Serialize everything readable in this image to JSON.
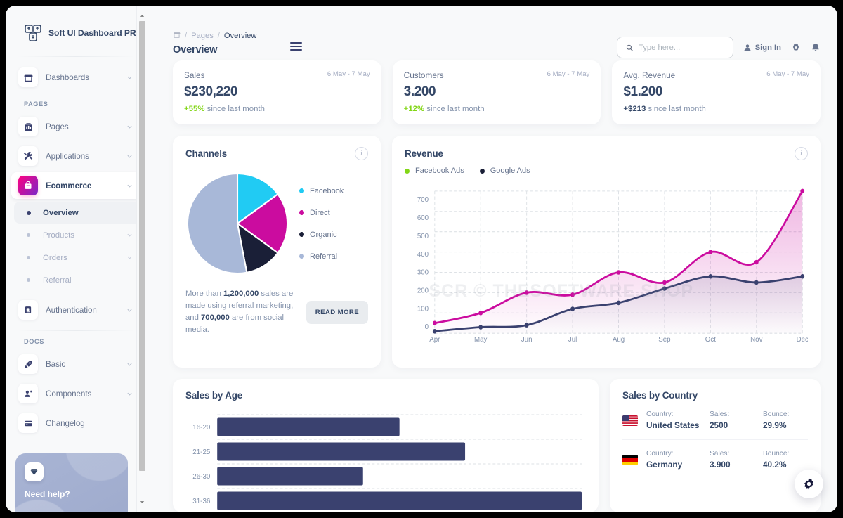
{
  "brand": {
    "name": "Soft UI Dashboard PRO",
    "logo_icon": "soft-ui-logo-icon"
  },
  "sidebar": {
    "groups": [
      {
        "label": "",
        "items": [
          {
            "label": "Dashboards",
            "icon": "shop-icon",
            "chevron": true,
            "active": false
          }
        ]
      },
      {
        "label": "PAGES",
        "items": [
          {
            "label": "Pages",
            "icon": "chart-bar-icon",
            "chevron": true,
            "active": false
          },
          {
            "label": "Applications",
            "icon": "tools-icon",
            "chevron": true,
            "active": false
          },
          {
            "label": "Ecommerce",
            "icon": "basket-icon",
            "chevron": true,
            "active": true
          },
          {
            "label": "Authentication",
            "icon": "document-icon",
            "chevron": true,
            "active": false
          }
        ]
      },
      {
        "label": "DOCS",
        "items": [
          {
            "label": "Basic",
            "icon": "rocket-icon",
            "chevron": true,
            "active": false
          },
          {
            "label": "Components",
            "icon": "badge-icon",
            "chevron": true,
            "active": false
          },
          {
            "label": "Changelog",
            "icon": "credit-card-icon",
            "chevron": false,
            "active": false
          }
        ]
      }
    ],
    "subitems": [
      {
        "label": "Overview",
        "chevron": false,
        "active": true
      },
      {
        "label": "Products",
        "chevron": true,
        "active": false
      },
      {
        "label": "Orders",
        "chevron": true,
        "active": false
      },
      {
        "label": "Referral",
        "chevron": false,
        "active": false
      }
    ],
    "help_card": {
      "title": "Need help?",
      "icon": "diamond-icon"
    }
  },
  "topbar": {
    "breadcrumb_home_icon": "shop-icon",
    "breadcrumb_parent": "Pages",
    "breadcrumb_current": "Overview",
    "separator": "/",
    "page_title": "Overview",
    "menu_icon": "hamburger-icon",
    "search": {
      "placeholder": "Type here...",
      "value": "",
      "icon": "search-icon"
    },
    "sign_in": {
      "label": "Sign In",
      "icon": "user-icon"
    },
    "settings_icon": "gear-icon",
    "bell_icon": "bell-icon"
  },
  "stats": [
    {
      "title": "Sales",
      "date": "6 May - 7 May",
      "value": "$230,220",
      "delta": "+55%",
      "delta_positive": true,
      "note": "since last month"
    },
    {
      "title": "Customers",
      "date": "6 May - 7 May",
      "value": "3.200",
      "delta": "+12%",
      "delta_positive": true,
      "note": "since last month"
    },
    {
      "title": "Avg. Revenue",
      "date": "6 May - 7 May",
      "value": "$1.200",
      "delta": "+$213",
      "delta_positive": false,
      "note": "since last month"
    }
  ],
  "channels": {
    "title": "Channels",
    "info_icon": "info-icon",
    "text_parts": {
      "a": "More than ",
      "b": "1,200,000",
      "c": " sales are made using referral marketing, and ",
      "d": "700,000",
      "e": " are from social media."
    },
    "button": "READ MORE"
  },
  "revenue": {
    "title": "Revenue",
    "info_icon": "info-icon",
    "watermark": "SCR © THESOFTWARE.SHOP"
  },
  "sales_by_age": {
    "title": "Sales by Age"
  },
  "sales_by_country": {
    "title": "Sales by Country",
    "labels": {
      "country": "Country:",
      "sales": "Sales:",
      "bounce": "Bounce:"
    },
    "rows": [
      {
        "flag": "us-flag-icon",
        "country": "United States",
        "sales": "2500",
        "bounce": "29.9%"
      },
      {
        "flag": "de-flag-icon",
        "country": "Germany",
        "sales": "3.900",
        "bounce": "40.2%"
      }
    ]
  },
  "fab": {
    "icon": "gear-icon"
  },
  "colors": {
    "facebook": "#21cbf3",
    "direct": "#cb0c9f",
    "organic": "#1a1f37",
    "referral": "#a8b8d8",
    "dark": "#344767",
    "green": "#82d616",
    "pink": "#cb0c9f",
    "navy": "#3a416f"
  },
  "chart_data": [
    {
      "type": "pie",
      "title": "Channels",
      "labels": [
        "Facebook",
        "Direct",
        "Organic",
        "Referral"
      ],
      "values": [
        15,
        20,
        12,
        53
      ],
      "colors": [
        "#21cbf3",
        "#cb0c9f",
        "#1a1f37",
        "#a8b8d8"
      ],
      "legend": "right"
    },
    {
      "type": "line",
      "title": "Revenue",
      "xlabel": "",
      "ylabel": "",
      "categories": [
        "Apr",
        "May",
        "Jun",
        "Jul",
        "Aug",
        "Sep",
        "Oct",
        "Nov",
        "Dec"
      ],
      "ylim": [
        0,
        700
      ],
      "yticks": [
        0,
        100,
        200,
        300,
        400,
        500,
        600,
        700
      ],
      "grid": true,
      "legend": "top-left",
      "series": [
        {
          "name": "Facebook Ads",
          "color": "#cb0c9f",
          "values": [
            50,
            100,
            200,
            190,
            300,
            250,
            400,
            350,
            700
          ]
        },
        {
          "name": "Google Ads",
          "color": "#3a416f",
          "values": [
            10,
            30,
            40,
            120,
            150,
            220,
            280,
            250,
            280
          ]
        }
      ]
    },
    {
      "type": "bar",
      "title": "Sales by Age",
      "orientation": "horizontal",
      "categories": [
        "16-20",
        "21-25",
        "26-30",
        "31-36"
      ],
      "values": [
        50,
        68,
        40,
        100
      ],
      "color": "#3a416f",
      "grid": true
    }
  ]
}
